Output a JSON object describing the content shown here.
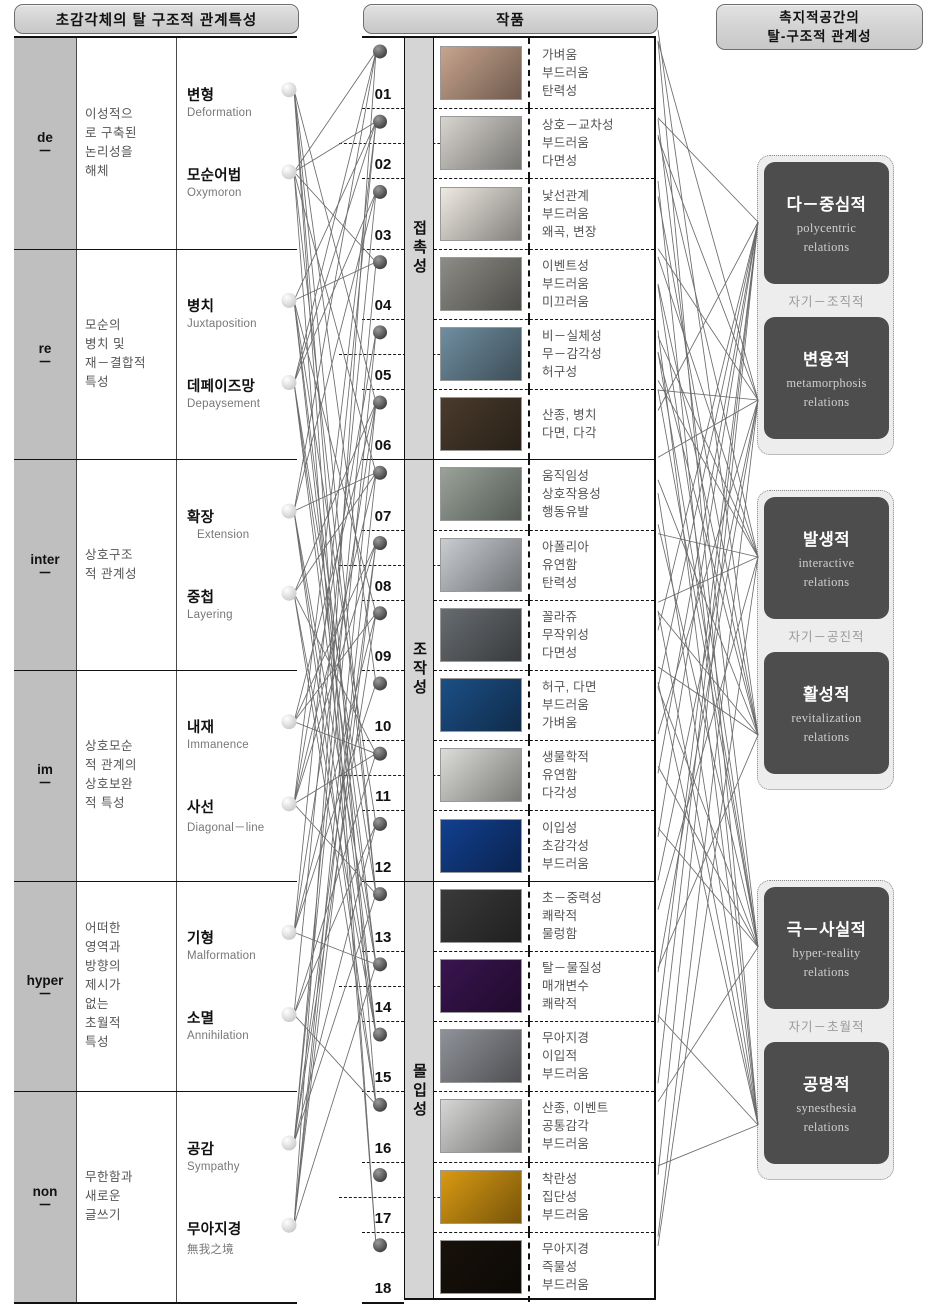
{
  "headers": {
    "left": "초감각체의 탈 구조적 관계특성",
    "mid": "작품",
    "right_line1": "촉지적공간의",
    "right_line2": "탈-구조적 관계성"
  },
  "prefixes": [
    {
      "code": "de",
      "dash": "－",
      "desc": "이성적으\n로 구축된\n논리성을\n해체",
      "terms": [
        {
          "ko": "변형",
          "en": "Deformation"
        },
        {
          "ko": "모순어법",
          "en": "Oxymoron"
        }
      ]
    },
    {
      "code": "re",
      "dash": "－",
      "desc": "모순의\n병치 및\n재－결합적\n특성",
      "terms": [
        {
          "ko": "병치",
          "en": "Juxtaposition"
        },
        {
          "ko": "데페이즈망",
          "en": "Depaysement"
        }
      ]
    },
    {
      "code": "inter",
      "dash": "－",
      "desc": "상호구조\n적 관계성",
      "terms": [
        {
          "ko": "확장",
          "en": "Extension"
        },
        {
          "ko": "중첩",
          "en": "Layering"
        }
      ]
    },
    {
      "code": "im",
      "dash": "－",
      "desc": "상호모순\n적 관계의\n상호보완\n적 특성",
      "terms": [
        {
          "ko": "내재",
          "en": "Immanence"
        },
        {
          "ko": "사선",
          "en": "Diagonal－line"
        }
      ]
    },
    {
      "code": "hyper",
      "dash": "－",
      "desc": "어떠한\n영역과\n방향의\n제시가\n없는\n초월적\n특성",
      "terms": [
        {
          "ko": "기형",
          "en": "Malformation"
        },
        {
          "ko": "소멸",
          "en": "Annihilation"
        }
      ]
    },
    {
      "code": "non",
      "dash": "－",
      "desc": "무한함과\n새로운\n글쓰기",
      "terms": [
        {
          "ko": "공감",
          "en": "Sympathy"
        },
        {
          "ko": "무아지경",
          "en": "無我之境"
        }
      ]
    }
  ],
  "categories": [
    {
      "label": "접촉성"
    },
    {
      "label": "조작성"
    },
    {
      "label": "몰입성"
    }
  ],
  "works": [
    {
      "num": "01",
      "keywords": [
        "가벼움",
        "부드러움",
        "탄력성"
      ],
      "thumb": "#c8a48e"
    },
    {
      "num": "02",
      "keywords": [
        "상호－교차성",
        "부드러움",
        "다면성"
      ],
      "thumb": "#d8d5cf"
    },
    {
      "num": "03",
      "keywords": [
        "낯선관계",
        "부드러움",
        "왜곡, 변장"
      ],
      "thumb": "#eeeae2"
    },
    {
      "num": "04",
      "keywords": [
        "이벤트성",
        "부드러움",
        "미끄러움"
      ],
      "thumb": "#8d8c86"
    },
    {
      "num": "05",
      "keywords": [
        "비－실체성",
        "무－감각성",
        "허구성"
      ],
      "thumb": "#6f8ea0"
    },
    {
      "num": "06",
      "keywords": [
        "산종, 병치",
        "다면, 다각"
      ],
      "thumb": "#4a3b2c"
    },
    {
      "num": "07",
      "keywords": [
        "움직임성",
        "상호작용성",
        "행동유발"
      ],
      "thumb": "#9aa39a"
    },
    {
      "num": "08",
      "keywords": [
        "아폴리아",
        "유연함",
        "탄력성"
      ],
      "thumb": "#c9cdd2"
    },
    {
      "num": "09",
      "keywords": [
        "꼴라쥬",
        "무작위성",
        "다면성"
      ],
      "thumb": "#676c70"
    },
    {
      "num": "10",
      "keywords": [
        "허구, 다면",
        "부드러움",
        "가벼움"
      ],
      "thumb": "#1c4f86"
    },
    {
      "num": "11",
      "keywords": [
        "생물학적",
        "유연함",
        "다각성"
      ],
      "thumb": "#dcdcd8"
    },
    {
      "num": "12",
      "keywords": [
        "이입성",
        "초감각성",
        "부드러움"
      ],
      "thumb": "#12408f"
    },
    {
      "num": "13",
      "keywords": [
        "초－중력성",
        "쾌락적",
        "물렁함"
      ],
      "thumb": "#3a3a3a"
    },
    {
      "num": "14",
      "keywords": [
        "탈－물질성",
        "매개변수",
        "쾌락적"
      ],
      "thumb": "#3a1450"
    },
    {
      "num": "15",
      "keywords": [
        "무아지경",
        "이입적",
        "부드러움"
      ],
      "thumb": "#8f9298"
    },
    {
      "num": "16",
      "keywords": [
        "산종, 이벤트",
        "공통감각",
        "부드러움"
      ],
      "thumb": "#d6d6d4"
    },
    {
      "num": "17",
      "keywords": [
        "착란성",
        "집단성",
        "부드러움"
      ],
      "thumb": "#d99a12"
    },
    {
      "num": "18",
      "keywords": [
        "무아지경",
        "즉물성",
        "부드러움"
      ],
      "thumb": "#17110a"
    }
  ],
  "relation_groups": [
    {
      "top": {
        "ko": "다－중심적",
        "en1": "polycentric",
        "en2": "relations"
      },
      "mid": "자기－조직적",
      "bottom": {
        "ko": "변용적",
        "en1": "metamorphosis",
        "en2": "relations"
      }
    },
    {
      "top": {
        "ko": "발생적",
        "en1": "interactive",
        "en2": "relations"
      },
      "mid": "자기－공진적",
      "bottom": {
        "ko": "활성적",
        "en1": "revitalization",
        "en2": "relations"
      }
    },
    {
      "top": {
        "ko": "극－사실적",
        "en1": "hyper-reality",
        "en2": "relations"
      },
      "mid": "자기－초월적",
      "bottom": {
        "ko": "공명적",
        "en1": "synesthesia",
        "en2": "relations"
      }
    }
  ],
  "colors": {
    "node_concept": "#f4f4f4",
    "node_work": "#5a5a5a",
    "header_fill": "#d2d2d2",
    "prefix_fill": "#bfbfbf",
    "category_fill": "#d5d5d5",
    "relation_box": "#4d4d4d",
    "link_line": "#6b6b6b"
  }
}
